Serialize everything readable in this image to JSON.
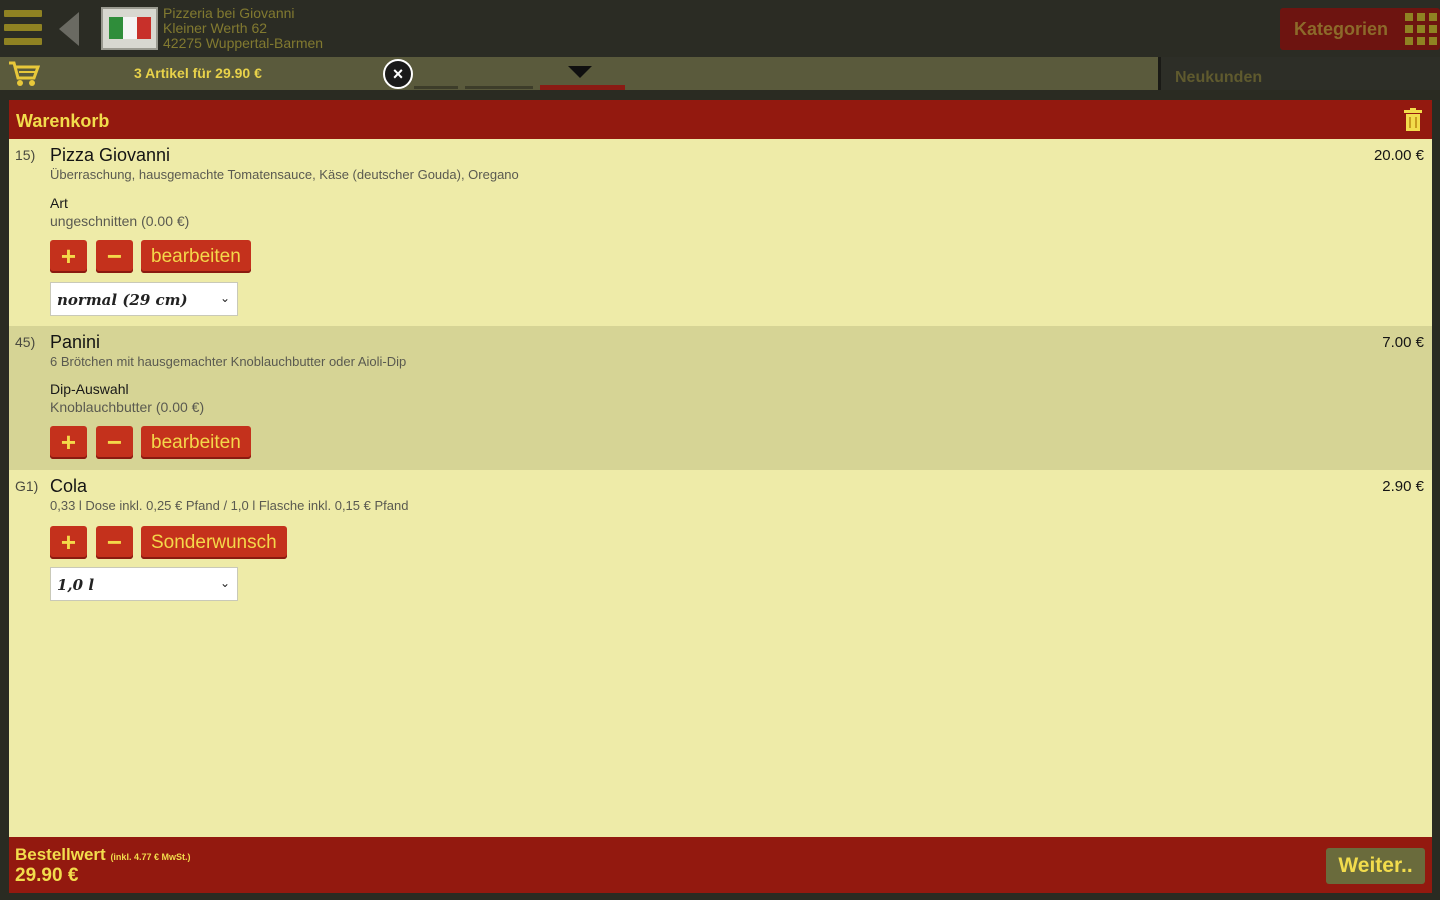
{
  "header": {
    "shop_name": "Pizzeria bei Giovanni",
    "street": "Kleiner Werth 62",
    "city": "42275 Wuppertal-Barmen",
    "categories_label": "Kategorien"
  },
  "cartbar": {
    "summary": "3 Artikel für 29.90 €",
    "newcustomers_label": "Neukunden"
  },
  "cart": {
    "title": "Warenkorb",
    "items": [
      {
        "num": "15)",
        "name": "Pizza Giovanni",
        "price": "20.00 €",
        "desc": "Überraschung, hausgemachte Tomatensauce, Käse (deutscher Gouda), Oregano",
        "option_name": "Art",
        "option_value": "ungeschnitten (0.00 €)",
        "edit_label": "bearbeiten",
        "size_select": "normal (29 cm)"
      },
      {
        "num": "45)",
        "name": "Panini",
        "price": "7.00 €",
        "desc": "6 Brötchen mit hausgemachter Knoblauchbutter oder Aioli-Dip",
        "option_name": "Dip-Auswahl",
        "option_value": "Knoblauchbutter (0.00 €)",
        "edit_label": "bearbeiten"
      },
      {
        "num": "G1)",
        "name": "Cola",
        "price": "2.90 €",
        "desc": "0,33 l Dose inkl. 0,25 € Pfand / 1,0 l Flasche inkl. 0,15 € Pfand",
        "edit_label": "Sonderwunsch",
        "size_select": "1,0 l"
      }
    ],
    "plus": "+",
    "minus": "−"
  },
  "footer": {
    "order_value_label": "Bestellwert",
    "vat_note": "(inkl. 4.77 € MwSt.)",
    "total": "29.90 €",
    "next_label": "Weiter.."
  },
  "colors": {
    "brand_red": "#93190f",
    "button_red": "#c4311c",
    "accent_yellow": "#f2dc4c",
    "panel_bg": "#eeeba8"
  }
}
